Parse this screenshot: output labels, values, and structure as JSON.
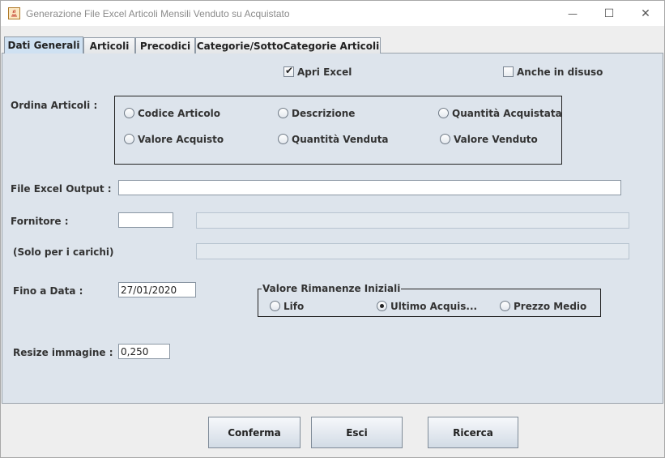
{
  "window": {
    "title": "Generazione File Excel Articoli Mensili Venduto su Acquistato",
    "icon": "java-app-icon",
    "controls": {
      "minimize": "—",
      "maximize": "☐",
      "close": "✕"
    }
  },
  "tabs": [
    {
      "label": "Dati Generali",
      "active": true
    },
    {
      "label": "Articoli",
      "active": false
    },
    {
      "label": "Precodici",
      "active": false
    },
    {
      "label": "Categorie/SottoCategorie Articoli",
      "active": false
    }
  ],
  "options": {
    "apri_excel": {
      "label": "Apri Excel",
      "checked": true
    },
    "anche_disuso": {
      "label": "Anche in disuso",
      "checked": false
    }
  },
  "ordina": {
    "label": "Ordina  Articoli :",
    "choices": [
      {
        "label": "Codice Articolo",
        "selected": false
      },
      {
        "label": "Descrizione",
        "selected": false
      },
      {
        "label": "Quantità Acquistata",
        "selected": false
      },
      {
        "label": "Valore Acquisto",
        "selected": false
      },
      {
        "label": "Quantità Venduta",
        "selected": false
      },
      {
        "label": "Valore Venduto",
        "selected": false
      }
    ]
  },
  "fields": {
    "file_excel": {
      "label": "File Excel Output :",
      "value": ""
    },
    "fornitore": {
      "label": "Fornitore :",
      "code": "",
      "name": ""
    },
    "solo_carichi": {
      "label": "(Solo per i carichi)",
      "value": ""
    },
    "fino_data": {
      "label": "Fino a Data :",
      "value": "27/01/2020"
    },
    "resize": {
      "label": "Resize immagine :",
      "value": "0,250"
    }
  },
  "rimanenze": {
    "title": "Valore Rimanenze Iniziali",
    "choices": [
      {
        "label": "Lifo",
        "selected": false
      },
      {
        "label": "Ultimo Acquis...",
        "selected": true
      },
      {
        "label": "Prezzo Medio",
        "selected": false
      }
    ]
  },
  "buttons": {
    "confirm": "Conferma",
    "exit": "Esci",
    "search": "Ricerca"
  }
}
